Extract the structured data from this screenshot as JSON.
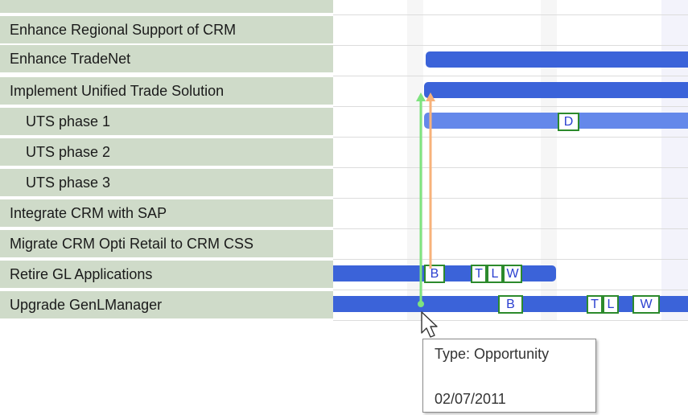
{
  "tasks": [
    {
      "label": "Enhance Regional Support of CRM",
      "indent": false
    },
    {
      "label": "Enhance TradeNet",
      "indent": false
    },
    {
      "label": "Implement Unified Trade Solution",
      "indent": false
    },
    {
      "label": "UTS phase 1",
      "indent": true
    },
    {
      "label": "UTS phase 2",
      "indent": true
    },
    {
      "label": "UTS phase 3",
      "indent": true
    },
    {
      "label": "Integrate CRM with SAP",
      "indent": false
    },
    {
      "label": "Migrate CRM Opti Retail to CRM CSS",
      "indent": false
    },
    {
      "label": "Retire GL Applications",
      "indent": false
    },
    {
      "label": "Upgrade GenLManager",
      "indent": false
    }
  ],
  "markers": {
    "uts_phase1_d": "D",
    "retire_b": "B",
    "retire_t": "T",
    "retire_l": "L",
    "retire_w": "W",
    "upgrade_b": "B",
    "upgrade_t": "T",
    "upgrade_l": "L",
    "upgrade_w": "W"
  },
  "tooltip": {
    "type_text": "Type: Opportunity",
    "date_text": "02/07/2011"
  },
  "colors": {
    "label_bg": "#cfdbc9",
    "bar": "#3b63d9",
    "bar_light": "#6488ea",
    "marker_border": "#2c8a2c",
    "dependency_green": "#7ee37e",
    "dependency_orange": "#f7b27a"
  }
}
